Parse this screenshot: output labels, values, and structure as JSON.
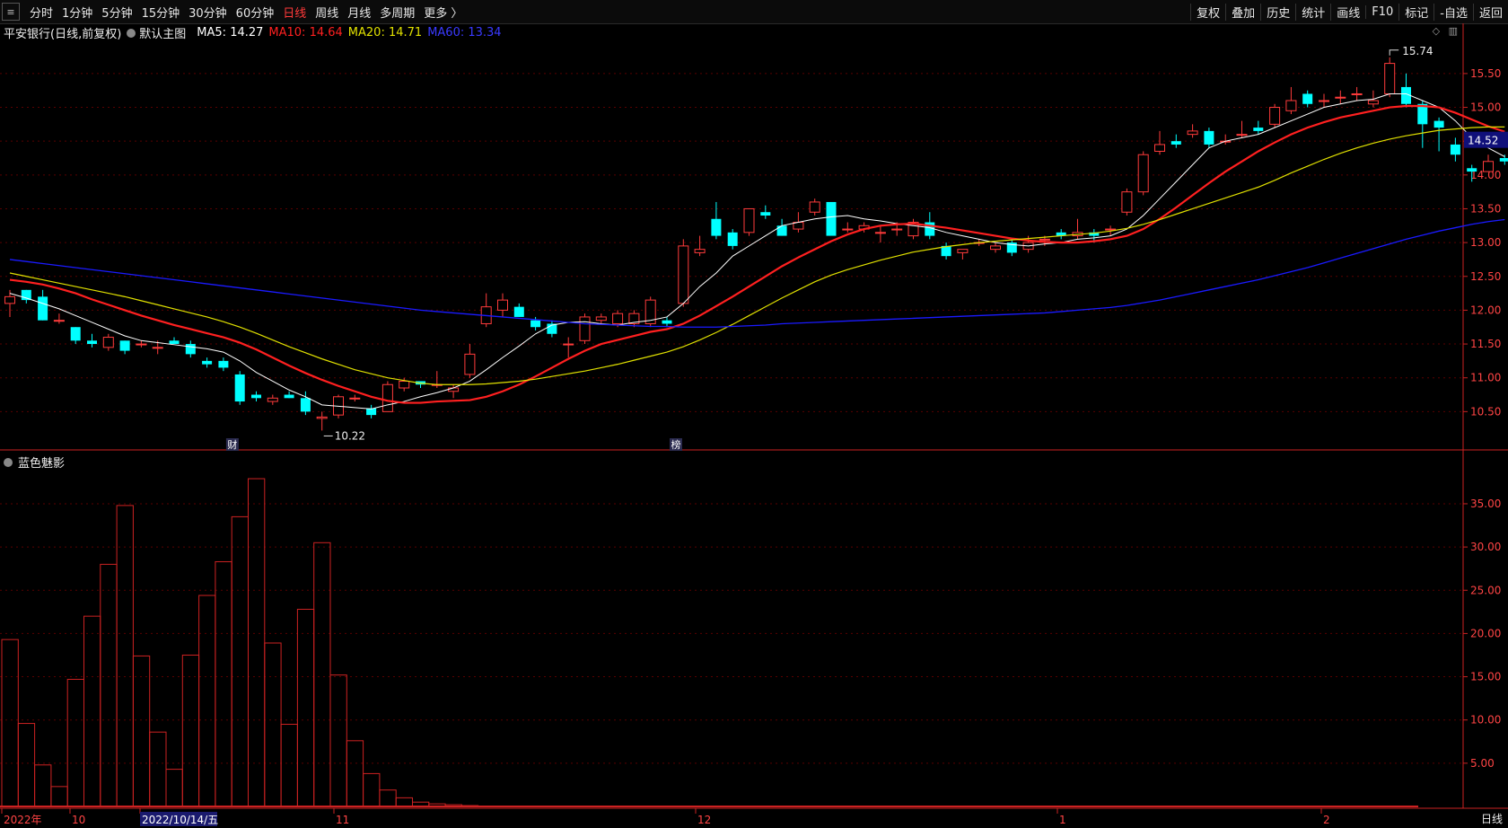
{
  "toolbar": {
    "periods": [
      "分时",
      "1分钟",
      "5分钟",
      "15分钟",
      "30分钟",
      "60分钟",
      "日线",
      "周线",
      "月线",
      "多周期",
      "更多 〉"
    ],
    "active_period": "日线",
    "right_buttons": [
      "复权",
      "叠加",
      "历史",
      "统计",
      "画线",
      "F10",
      "标记",
      "-自选",
      "返回"
    ]
  },
  "main_info": {
    "stock": "平安银行(日线,前复权)",
    "template": "默认主图",
    "ma5": "MA5: 14.27",
    "ma10": "MA10: 14.64",
    "ma20": "MA20: 14.71",
    "ma60": "MA60: 13.34"
  },
  "sub_info": {
    "indicator": "蓝色魅影"
  },
  "annotations": {
    "high_label": "15.74",
    "low_label": "10.22",
    "current_price": "14.52",
    "event_cai": "财",
    "event_bang": "榜"
  },
  "colors": {
    "up": "#ff3b3b",
    "down": "#00ffff",
    "ma5": "#ffffff",
    "ma10": "#ff2020",
    "ma20": "#e0e000",
    "ma60": "#1a1aff",
    "grid": "#5a0000",
    "axis": "#cc2222"
  },
  "bottom_tab": "日线",
  "chart_data": [
    {
      "type": "candlestick",
      "title": "平安银行(日线,前复权)",
      "price_axis_ticks": [
        "15.50",
        "15.00",
        "14.50",
        "14.00",
        "13.50",
        "13.00",
        "12.50",
        "12.00",
        "11.50",
        "11.00",
        "10.50"
      ],
      "ylim": [
        10.0,
        15.95
      ],
      "x_labels": [
        "2022年",
        "10",
        "2022/10/14/五",
        "11",
        "12",
        "1",
        "2"
      ],
      "candles": [
        [
          12.1,
          12.3,
          11.9,
          12.2
        ],
        [
          12.3,
          12.3,
          12.1,
          12.15
        ],
        [
          12.2,
          12.3,
          11.85,
          11.85
        ],
        [
          11.85,
          11.95,
          11.8,
          11.85
        ],
        [
          11.75,
          11.75,
          11.5,
          11.55
        ],
        [
          11.55,
          11.65,
          11.45,
          11.5
        ],
        [
          11.45,
          11.65,
          11.4,
          11.6
        ],
        [
          11.55,
          11.55,
          11.35,
          11.4
        ],
        [
          11.5,
          11.55,
          11.45,
          11.5
        ],
        [
          11.45,
          11.55,
          11.35,
          11.45
        ],
        [
          11.55,
          11.6,
          11.5,
          11.5
        ],
        [
          11.5,
          11.55,
          11.3,
          11.35
        ],
        [
          11.25,
          11.3,
          11.15,
          11.2
        ],
        [
          11.25,
          11.3,
          11.1,
          11.15
        ],
        [
          11.05,
          11.1,
          10.6,
          10.65
        ],
        [
          10.75,
          10.8,
          10.65,
          10.7
        ],
        [
          10.65,
          10.75,
          10.6,
          10.7
        ],
        [
          10.75,
          10.8,
          10.7,
          10.7
        ],
        [
          10.7,
          10.8,
          10.45,
          10.5
        ],
        [
          10.4,
          10.5,
          10.22,
          10.42
        ],
        [
          10.45,
          10.75,
          10.4,
          10.72
        ],
        [
          10.7,
          10.75,
          10.65,
          10.7
        ],
        [
          10.55,
          10.6,
          10.4,
          10.45
        ],
        [
          10.5,
          10.95,
          10.5,
          10.9
        ],
        [
          10.85,
          11.0,
          10.8,
          10.95
        ],
        [
          10.95,
          10.95,
          10.85,
          10.9
        ],
        [
          10.9,
          11.1,
          10.85,
          10.9
        ],
        [
          10.8,
          10.9,
          10.7,
          10.85
        ],
        [
          11.05,
          11.5,
          11.0,
          11.35
        ],
        [
          11.8,
          12.25,
          11.75,
          12.05
        ],
        [
          12.0,
          12.25,
          11.9,
          12.15
        ],
        [
          12.05,
          12.1,
          11.9,
          11.9
        ],
        [
          11.85,
          11.9,
          11.7,
          11.75
        ],
        [
          11.8,
          11.85,
          11.6,
          11.65
        ],
        [
          11.5,
          11.6,
          11.3,
          11.5
        ],
        [
          11.55,
          11.95,
          11.5,
          11.9
        ],
        [
          11.85,
          11.95,
          11.8,
          11.9
        ],
        [
          11.8,
          12.0,
          11.75,
          11.95
        ],
        [
          11.8,
          12.0,
          11.75,
          11.95
        ],
        [
          11.8,
          12.2,
          11.75,
          12.15
        ],
        [
          11.85,
          11.9,
          11.75,
          11.8
        ],
        [
          12.1,
          13.05,
          12.05,
          12.95
        ],
        [
          12.85,
          13.1,
          12.8,
          12.9
        ],
        [
          13.35,
          13.6,
          13.05,
          13.1
        ],
        [
          13.15,
          13.2,
          12.9,
          12.95
        ],
        [
          13.15,
          13.5,
          13.1,
          13.5
        ],
        [
          13.45,
          13.55,
          13.35,
          13.4
        ],
        [
          13.25,
          13.35,
          13.1,
          13.1
        ],
        [
          13.2,
          13.45,
          13.15,
          13.3
        ],
        [
          13.45,
          13.65,
          13.4,
          13.6
        ],
        [
          13.6,
          13.6,
          13.15,
          13.1
        ],
        [
          13.2,
          13.3,
          13.15,
          13.2
        ],
        [
          13.2,
          13.3,
          13.15,
          13.25
        ],
        [
          13.15,
          13.25,
          13.0,
          13.15
        ],
        [
          13.2,
          13.3,
          13.1,
          13.2
        ],
        [
          13.1,
          13.35,
          13.05,
          13.3
        ],
        [
          13.3,
          13.45,
          13.05,
          13.1
        ],
        [
          12.95,
          13.0,
          12.75,
          12.8
        ],
        [
          12.85,
          12.9,
          12.75,
          12.9
        ],
        [
          13.0,
          13.05,
          12.95,
          13.0
        ],
        [
          12.9,
          13.0,
          12.85,
          12.95
        ],
        [
          13.0,
          13.05,
          12.8,
          12.85
        ],
        [
          12.9,
          13.1,
          12.85,
          13.0
        ],
        [
          13.05,
          13.1,
          12.95,
          13.05
        ],
        [
          13.15,
          13.2,
          13.05,
          13.1
        ],
        [
          13.1,
          13.35,
          13.05,
          13.15
        ],
        [
          13.15,
          13.2,
          13.0,
          13.1
        ],
        [
          13.2,
          13.25,
          13.1,
          13.2
        ],
        [
          13.45,
          13.8,
          13.4,
          13.75
        ],
        [
          13.75,
          14.35,
          13.7,
          14.3
        ],
        [
          14.35,
          14.65,
          14.3,
          14.45
        ],
        [
          14.5,
          14.6,
          14.4,
          14.45
        ],
        [
          14.6,
          14.75,
          14.55,
          14.65
        ],
        [
          14.65,
          14.7,
          14.4,
          14.45
        ],
        [
          14.5,
          14.6,
          14.45,
          14.5
        ],
        [
          14.6,
          14.8,
          14.55,
          14.6
        ],
        [
          14.7,
          14.8,
          14.6,
          14.65
        ],
        [
          14.75,
          15.05,
          14.7,
          15.0
        ],
        [
          14.95,
          15.3,
          14.9,
          15.1
        ],
        [
          15.2,
          15.25,
          15.0,
          15.05
        ],
        [
          15.1,
          15.2,
          15.0,
          15.1
        ],
        [
          15.15,
          15.25,
          15.05,
          15.15
        ],
        [
          15.2,
          15.3,
          15.1,
          15.2
        ],
        [
          15.05,
          15.25,
          15.0,
          15.1
        ],
        [
          15.2,
          15.74,
          15.15,
          15.65
        ],
        [
          15.3,
          15.5,
          15.0,
          15.05
        ],
        [
          15.05,
          15.1,
          14.4,
          14.75
        ],
        [
          14.8,
          14.85,
          14.35,
          14.7
        ],
        [
          14.45,
          14.55,
          14.2,
          14.3
        ],
        [
          14.1,
          14.15,
          13.9,
          14.05
        ],
        [
          14.05,
          14.3,
          14.05,
          14.2
        ],
        [
          14.25,
          14.3,
          14.15,
          14.2
        ]
      ],
      "series": [
        {
          "name": "MA5",
          "values": [
            12.25,
            12.18,
            12.1,
            12.02,
            11.92,
            11.82,
            11.72,
            11.62,
            11.55,
            11.52,
            11.49,
            11.46,
            11.43,
            11.38,
            11.25,
            11.08,
            10.95,
            10.82,
            10.72,
            10.6,
            10.58,
            10.56,
            10.54,
            10.6,
            10.65,
            10.72,
            10.78,
            10.85,
            10.95,
            11.12,
            11.3,
            11.47,
            11.65,
            11.78,
            11.82,
            11.83,
            11.8,
            11.78,
            11.82,
            11.85,
            11.9,
            12.1,
            12.35,
            12.55,
            12.8,
            12.95,
            13.1,
            13.25,
            13.3,
            13.35,
            13.38,
            13.4,
            13.35,
            13.32,
            13.28,
            13.25,
            13.22,
            13.15,
            13.1,
            13.05,
            13.0,
            12.97,
            12.95,
            12.98,
            13.0,
            13.05,
            13.07,
            13.1,
            13.2,
            13.4,
            13.65,
            13.9,
            14.15,
            14.4,
            14.5,
            14.55,
            14.6,
            14.7,
            14.8,
            14.9,
            15.0,
            15.05,
            15.1,
            15.12,
            15.2,
            15.2,
            15.1,
            15.0,
            14.8,
            14.55,
            14.4,
            14.27
          ]
        },
        {
          "name": "MA10",
          "values": [
            12.45,
            12.42,
            12.38,
            12.32,
            12.25,
            12.16,
            12.08,
            12.0,
            11.92,
            11.85,
            11.78,
            11.72,
            11.66,
            11.6,
            11.52,
            11.42,
            11.3,
            11.18,
            11.07,
            10.97,
            10.88,
            10.8,
            10.72,
            10.66,
            10.63,
            10.63,
            10.65,
            10.66,
            10.67,
            10.72,
            10.8,
            10.9,
            11.02,
            11.15,
            11.28,
            11.4,
            11.5,
            11.56,
            11.62,
            11.68,
            11.72,
            11.8,
            11.92,
            12.06,
            12.2,
            12.35,
            12.5,
            12.65,
            12.78,
            12.9,
            13.02,
            13.12,
            13.2,
            13.25,
            13.27,
            13.28,
            13.25,
            13.22,
            13.18,
            13.14,
            13.1,
            13.06,
            13.03,
            13.01,
            13.0,
            13.0,
            13.02,
            13.05,
            13.1,
            13.2,
            13.35,
            13.52,
            13.7,
            13.88,
            14.05,
            14.2,
            14.35,
            14.48,
            14.6,
            14.7,
            14.78,
            14.85,
            14.9,
            14.95,
            15.0,
            15.02,
            15.02,
            15.0,
            14.92,
            14.82,
            14.72,
            14.64
          ]
        },
        {
          "name": "MA20",
          "values": [
            12.55,
            12.5,
            12.45,
            12.4,
            12.35,
            12.3,
            12.25,
            12.2,
            12.14,
            12.08,
            12.02,
            11.96,
            11.9,
            11.83,
            11.75,
            11.66,
            11.56,
            11.46,
            11.37,
            11.28,
            11.2,
            11.12,
            11.06,
            11.0,
            10.96,
            10.92,
            10.9,
            10.9,
            10.9,
            10.91,
            10.93,
            10.95,
            10.98,
            11.02,
            11.06,
            11.1,
            11.15,
            11.2,
            11.26,
            11.32,
            11.38,
            11.46,
            11.56,
            11.67,
            11.79,
            11.92,
            12.05,
            12.18,
            12.3,
            12.42,
            12.52,
            12.6,
            12.67,
            12.74,
            12.8,
            12.86,
            12.9,
            12.94,
            12.97,
            13.0,
            13.02,
            13.04,
            13.06,
            13.08,
            13.1,
            13.12,
            13.14,
            13.17,
            13.21,
            13.27,
            13.34,
            13.42,
            13.5,
            13.58,
            13.66,
            13.74,
            13.82,
            13.92,
            14.03,
            14.13,
            14.23,
            14.32,
            14.4,
            14.47,
            14.53,
            14.58,
            14.62,
            14.66,
            14.68,
            14.7,
            14.71,
            14.71
          ]
        },
        {
          "name": "MA60",
          "values": [
            12.75,
            12.72,
            12.69,
            12.66,
            12.63,
            12.6,
            12.57,
            12.54,
            12.51,
            12.48,
            12.45,
            12.42,
            12.39,
            12.36,
            12.33,
            12.3,
            12.27,
            12.24,
            12.21,
            12.18,
            12.15,
            12.12,
            12.09,
            12.06,
            12.03,
            12.0,
            11.98,
            11.96,
            11.94,
            11.92,
            11.9,
            11.88,
            11.86,
            11.84,
            11.82,
            11.8,
            11.79,
            11.78,
            11.77,
            11.76,
            11.76,
            11.75,
            11.75,
            11.75,
            11.76,
            11.77,
            11.78,
            11.8,
            11.81,
            11.82,
            11.83,
            11.84,
            11.85,
            11.86,
            11.87,
            11.88,
            11.89,
            11.9,
            11.91,
            11.92,
            11.93,
            11.94,
            11.95,
            11.96,
            11.98,
            12.0,
            12.02,
            12.04,
            12.07,
            12.11,
            12.15,
            12.2,
            12.25,
            12.3,
            12.35,
            12.4,
            12.45,
            12.51,
            12.57,
            12.63,
            12.7,
            12.77,
            12.84,
            12.91,
            12.98,
            13.05,
            13.11,
            13.17,
            13.22,
            13.27,
            13.31,
            13.34
          ]
        }
      ]
    },
    {
      "type": "bar",
      "title": "蓝色魅影",
      "y_ticks": [
        "35.00",
        "30.00",
        "25.00",
        "20.00",
        "15.00",
        "10.00",
        "5.00"
      ],
      "ylim": [
        0,
        40.5
      ],
      "values": [
        19.3,
        9.6,
        4.8,
        2.3,
        14.7,
        22.0,
        28.0,
        34.8,
        17.4,
        8.6,
        4.3,
        17.5,
        24.4,
        28.3,
        33.5,
        37.9,
        18.9,
        9.5,
        22.8,
        30.5,
        15.2,
        7.6,
        3.8,
        1.9,
        1.0,
        0.5,
        0.3,
        0.2,
        0.1,
        0.05
      ]
    }
  ]
}
